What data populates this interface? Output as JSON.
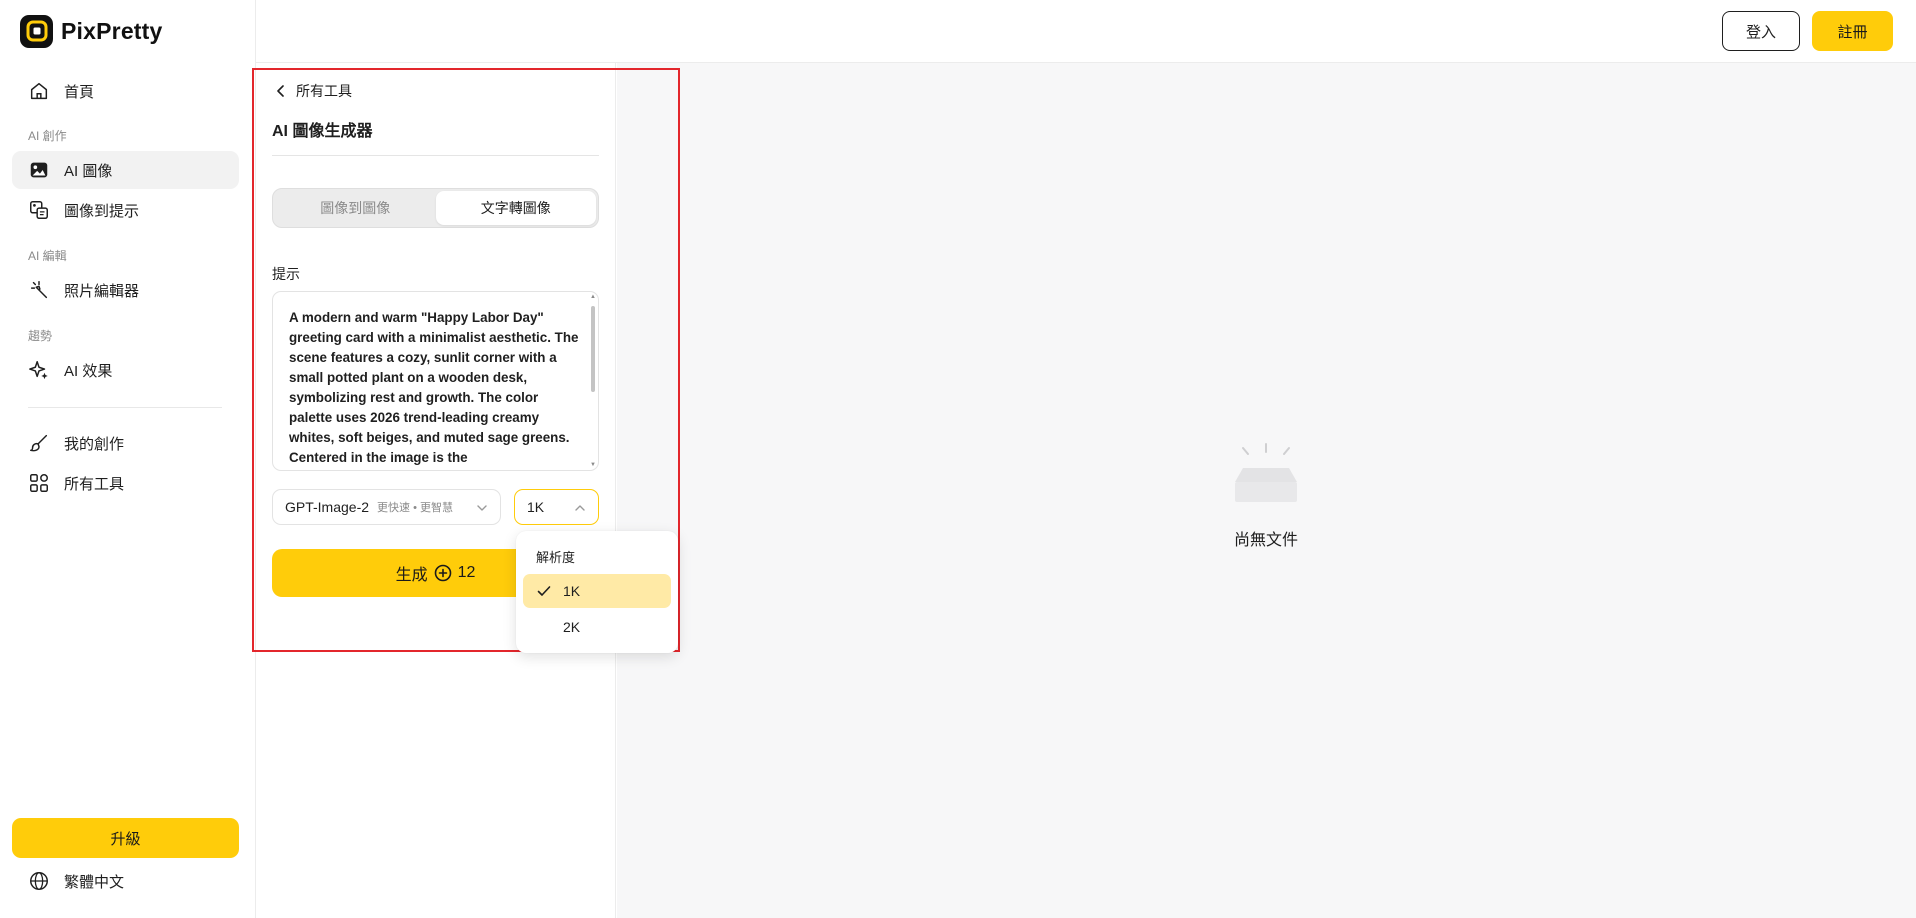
{
  "app": {
    "name": "PixPretty",
    "accent": "#ffcc0a"
  },
  "sidebar": {
    "home": "首頁",
    "sections": {
      "ai_create": "AI 創作",
      "ai_edit": "AI 編輯",
      "trends": "趨勢"
    },
    "items": {
      "ai_image": "AI 圖像",
      "image_to_prompt": "圖像到提示",
      "photo_editor": "照片編輯器",
      "ai_effects": "AI 效果",
      "my_creations": "我的創作",
      "all_tools": "所有工具"
    },
    "upgrade": "升級",
    "language": "繁體中文"
  },
  "topbar": {
    "login": "登入",
    "register": "註冊"
  },
  "tool": {
    "back": "所有工具",
    "title": "AI 圖像生成器",
    "tabs": [
      "圖像到圖像",
      "文字轉圖像"
    ],
    "active_tab": "文字轉圖像",
    "prompt_label": "提示",
    "prompt_text": "A modern and warm \"Happy Labor Day\" greeting card with a minimalist aesthetic. The scene features a cozy, sunlit corner with a small potted plant on a wooden desk, symbolizing rest and growth. The color palette uses 2026 trend-leading creamy whites, soft beiges, and muted sage greens. Centered in the image is the",
    "model": {
      "name": "GPT-Image-2",
      "desc": "更快速 • 更智慧"
    },
    "resolution": "1K",
    "generate": {
      "label": "生成",
      "credits": "12"
    }
  },
  "dropdown": {
    "header": "解析度",
    "options": [
      "1K",
      "2K"
    ],
    "selected": "1K"
  },
  "main": {
    "empty_text": "尚無文件"
  }
}
